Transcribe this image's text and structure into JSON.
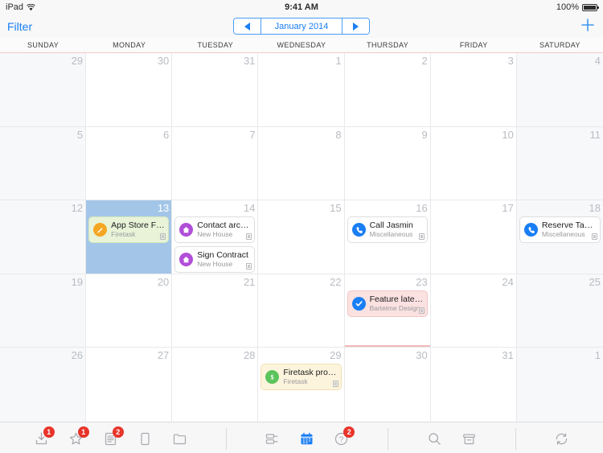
{
  "status_bar": {
    "device": "iPad",
    "wifi_icon": "wifi-icon",
    "time": "9:41 AM",
    "battery_percent": "100%"
  },
  "nav_bar": {
    "filter_label": "Filter",
    "prev_icon": "triangle-left-icon",
    "month_label": "January 2014",
    "next_icon": "triangle-right-icon",
    "add_icon": "plus-icon"
  },
  "weekdays": [
    "SUNDAY",
    "MONDAY",
    "TUESDAY",
    "WEDNESDAY",
    "THURSDAY",
    "FRIDAY",
    "SATURDAY"
  ],
  "calendar": {
    "weeks": [
      [
        {
          "day": "29",
          "other_month": true,
          "weekend": true,
          "selected": false,
          "events": []
        },
        {
          "day": "30",
          "other_month": true,
          "weekend": false,
          "selected": false,
          "events": []
        },
        {
          "day": "31",
          "other_month": true,
          "weekend": false,
          "selected": false,
          "events": []
        },
        {
          "day": "1",
          "other_month": false,
          "weekend": false,
          "selected": false,
          "events": []
        },
        {
          "day": "2",
          "other_month": false,
          "weekend": false,
          "selected": false,
          "events": []
        },
        {
          "day": "3",
          "other_month": false,
          "weekend": false,
          "selected": false,
          "events": []
        },
        {
          "day": "4",
          "other_month": false,
          "weekend": true,
          "selected": false,
          "events": []
        }
      ],
      [
        {
          "day": "5",
          "weekend": true,
          "selected": false,
          "events": []
        },
        {
          "day": "6",
          "weekend": false,
          "selected": false,
          "events": []
        },
        {
          "day": "7",
          "weekend": false,
          "selected": false,
          "events": []
        },
        {
          "day": "8",
          "weekend": false,
          "selected": false,
          "events": []
        },
        {
          "day": "9",
          "weekend": false,
          "selected": false,
          "events": []
        },
        {
          "day": "10",
          "weekend": false,
          "selected": false,
          "events": []
        },
        {
          "day": "11",
          "weekend": true,
          "selected": false,
          "events": []
        }
      ],
      [
        {
          "day": "12",
          "weekend": true,
          "selected": false,
          "events": []
        },
        {
          "day": "13",
          "weekend": false,
          "selected": true,
          "events": [
            {
              "title": "App Store Fe…",
              "subtitle": "Firetask",
              "icon": "pencil-icon",
              "icon_color": "ic-orange",
              "card_color": "green",
              "has_note": true
            }
          ]
        },
        {
          "day": "14",
          "weekend": false,
          "selected": false,
          "events": [
            {
              "title": "Contact archi…",
              "subtitle": "New House",
              "icon": "house-icon",
              "icon_color": "ic-purple",
              "card_color": "white",
              "has_note": true
            },
            {
              "title": "Sign Contract",
              "subtitle": "New House",
              "icon": "house-icon",
              "icon_color": "ic-purple",
              "card_color": "white",
              "has_note": true
            }
          ]
        },
        {
          "day": "15",
          "weekend": false,
          "selected": false,
          "events": []
        },
        {
          "day": "16",
          "weekend": false,
          "selected": false,
          "events": [
            {
              "title": "Call Jasmin",
              "subtitle": "Miscellaneous",
              "icon": "phone-icon",
              "icon_color": "ic-blue",
              "card_color": "white",
              "has_note": true
            }
          ]
        },
        {
          "day": "17",
          "weekend": false,
          "selected": false,
          "events": []
        },
        {
          "day": "18",
          "weekend": true,
          "selected": false,
          "events": [
            {
              "title": "Reserve Tabl…",
              "subtitle": "Miscellaneous",
              "icon": "phone-icon",
              "icon_color": "ic-blue",
              "card_color": "white",
              "has_note": true
            }
          ]
        }
      ],
      [
        {
          "day": "19",
          "weekend": true,
          "selected": false,
          "events": []
        },
        {
          "day": "20",
          "weekend": false,
          "selected": false,
          "events": []
        },
        {
          "day": "21",
          "weekend": false,
          "selected": false,
          "events": []
        },
        {
          "day": "22",
          "weekend": false,
          "selected": false,
          "events": []
        },
        {
          "day": "23",
          "weekend": false,
          "selected": false,
          "today": true,
          "events": [
            {
              "title": "Feature lates…",
              "subtitle": "Bartelme Design",
              "icon": "checkmark-icon",
              "icon_color": "ic-blue",
              "card_color": "pink",
              "has_note": true
            }
          ]
        },
        {
          "day": "24",
          "weekend": false,
          "selected": false,
          "events": []
        },
        {
          "day": "25",
          "weekend": true,
          "selected": false,
          "events": []
        }
      ],
      [
        {
          "day": "26",
          "weekend": true,
          "selected": false,
          "events": []
        },
        {
          "day": "27",
          "weekend": false,
          "selected": false,
          "events": []
        },
        {
          "day": "28",
          "weekend": false,
          "selected": false,
          "events": []
        },
        {
          "day": "29",
          "weekend": false,
          "selected": false,
          "events": [
            {
              "title": "Firetask pro…",
              "subtitle": "Firetask",
              "icon": "dollar-icon",
              "icon_color": "ic-green",
              "card_color": "cream",
              "has_note": true
            }
          ]
        },
        {
          "day": "30",
          "weekend": false,
          "selected": false,
          "events": []
        },
        {
          "day": "31",
          "weekend": false,
          "selected": false,
          "events": []
        },
        {
          "day": "1",
          "other_month": true,
          "weekend": true,
          "selected": false,
          "events": []
        }
      ]
    ]
  },
  "toolbar": {
    "groups": [
      {
        "items": [
          {
            "name": "inbox-icon",
            "badge": "1"
          },
          {
            "name": "star-icon",
            "badge": "1"
          },
          {
            "name": "list-icon",
            "badge": "2"
          },
          {
            "name": "page-icon",
            "badge": null
          },
          {
            "name": "folder-icon",
            "badge": null
          }
        ]
      },
      {
        "items": [
          {
            "name": "projects-icon",
            "badge": null
          },
          {
            "name": "calendar-icon",
            "badge": null,
            "active": true
          },
          {
            "name": "help-icon",
            "badge": "2"
          }
        ]
      },
      {
        "items": [
          {
            "name": "search-icon",
            "badge": null
          },
          {
            "name": "archive-icon",
            "badge": null
          }
        ]
      },
      {
        "items": [
          {
            "name": "sync-icon",
            "badge": null
          }
        ]
      }
    ]
  },
  "colors": {
    "accent_blue": "#1a7ef4",
    "selected_day": "#a3c6e8",
    "badge_red": "#e8342a",
    "toolbar_bg": "#f7f7f8"
  }
}
